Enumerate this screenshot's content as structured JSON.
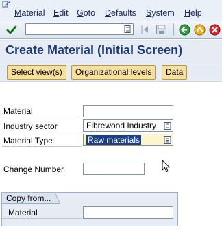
{
  "menubar": {
    "items": [
      {
        "underline": "M",
        "rest": "aterial"
      },
      {
        "underline": "E",
        "rest": "dit"
      },
      {
        "underline": "G",
        "rest": "oto"
      },
      {
        "underline": "D",
        "rest": "efaults"
      },
      {
        "underline": "S",
        "rest": "ystem"
      },
      {
        "underline": "H",
        "rest": "elp"
      }
    ]
  },
  "toolbar": {
    "command_value": "",
    "icons": [
      "system-menu-icon",
      "enter-check-icon",
      "dropdown-icon",
      "nav-left-icon",
      "save-icon",
      "back-icon",
      "exit-icon",
      "cancel-icon"
    ]
  },
  "title": "Create Material (Initial Screen)",
  "app_toolbar": {
    "select_views": "Select view(s)",
    "org_levels": "Organizational levels",
    "data": "Data"
  },
  "form": {
    "material_label": "Material",
    "material_value": "",
    "industry_label": "Industry sector",
    "industry_value": "Fibrewood Industry",
    "mattype_label": "Material Type",
    "mattype_value": "Raw materials",
    "change_label": "Change Number",
    "change_value": ""
  },
  "copy_from": {
    "title": "Copy from...",
    "material_label": "Material",
    "material_value": ""
  },
  "colors": {
    "title": "#1d3a78",
    "button_bg": "#f7df9f",
    "selection": "#1a3f8a"
  }
}
